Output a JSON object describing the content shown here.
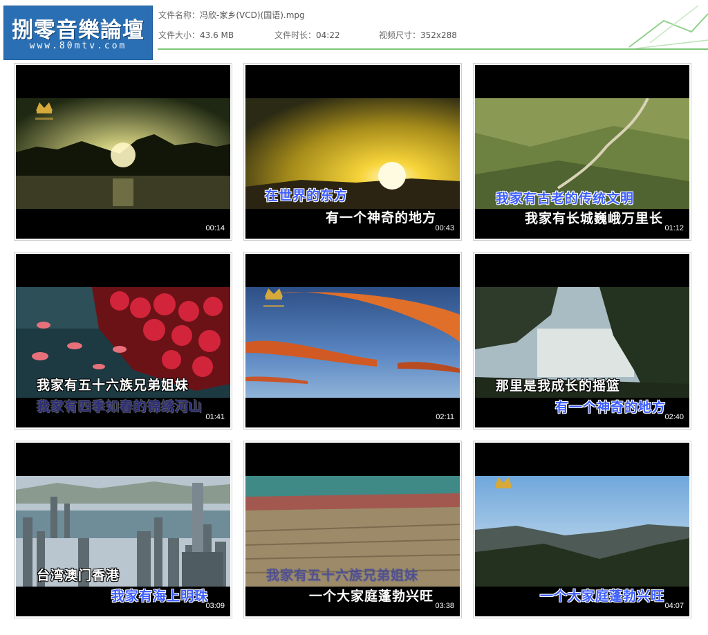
{
  "logo": {
    "title": "捌零音樂論壇",
    "url": "www.80mtv.com"
  },
  "file_info": {
    "name_label": "文件名称：",
    "name_value": "冯欣-家乡(VCD)(国语).mpg",
    "size_label": "文件大小：",
    "size_value": "43.6 MB",
    "duration_label": "文件时长：",
    "duration_value": "04:22",
    "resolution_label": "视频尺寸：",
    "resolution_value": "352x288"
  },
  "thumbnails": [
    {
      "time": "00:14",
      "scene": "sunset-over-mountains-icon",
      "subtitles": []
    },
    {
      "time": "00:43",
      "scene": "sunrise-horizon-icon",
      "subtitles": [
        "在世界的东方",
        "有一个神奇的地方"
      ]
    },
    {
      "time": "01:12",
      "scene": "great-wall-icon",
      "subtitles": [
        "我家有古老的传统文明",
        "我家有长城巍峨万里长"
      ]
    },
    {
      "time": "01:41",
      "scene": "roses-petals-icon",
      "subtitles": [
        "我家有五十六族兄弟姐妹",
        "我家有四季如春的锦绣河山"
      ]
    },
    {
      "time": "02:11",
      "scene": "sunset-clouds-icon",
      "subtitles": []
    },
    {
      "time": "02:40",
      "scene": "trees-sky-icon",
      "subtitles": [
        "那里是我成长的摇篮",
        "有一个神奇的地方"
      ]
    },
    {
      "time": "03:09",
      "scene": "hong-kong-skyline-icon",
      "subtitles": [
        "台湾澳门香港",
        "我家有海上明珠"
      ]
    },
    {
      "time": "03:38",
      "scene": "crowd-field-icon",
      "subtitles": [
        "我家有五十六族兄弟姐妹",
        "一个大家庭蓬勃兴旺"
      ]
    },
    {
      "time": "04:07",
      "scene": "mountain-valley-icon",
      "subtitles": [
        "",
        "一个大家庭蓬勃兴旺"
      ]
    }
  ]
}
